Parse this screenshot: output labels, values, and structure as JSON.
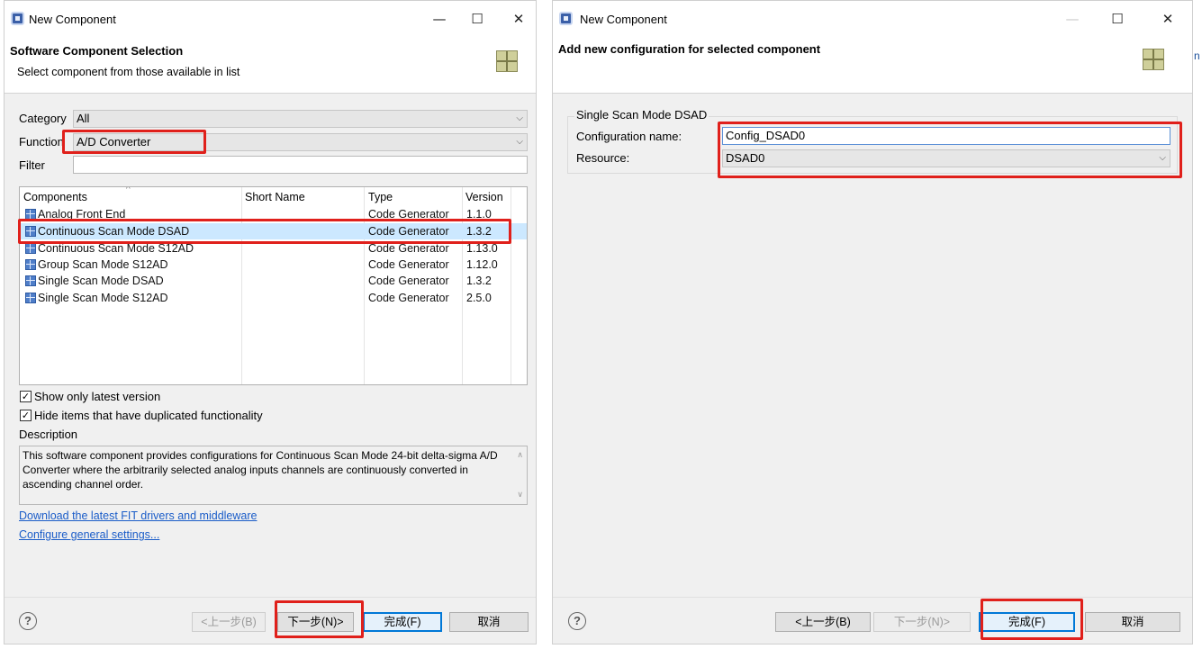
{
  "left_dialog": {
    "title": "New Component",
    "header_title": "Software Component Selection",
    "header_subtitle": "Select component from those available in list",
    "category_label": "Category",
    "category_value": "All",
    "function_label": "Function",
    "function_value": "A/D Converter",
    "filter_label": "Filter",
    "filter_value": "",
    "table": {
      "columns": [
        "Components",
        "Short Name",
        "Type",
        "Version"
      ],
      "rows": [
        {
          "name": "Analog Front End",
          "short": "",
          "type": "Code Generator",
          "version": "1.1.0"
        },
        {
          "name": "Continuous Scan Mode DSAD",
          "short": "",
          "type": "Code Generator",
          "version": "1.3.2"
        },
        {
          "name": "Continuous Scan Mode S12AD",
          "short": "",
          "type": "Code Generator",
          "version": "1.13.0"
        },
        {
          "name": "Group Scan Mode S12AD",
          "short": "",
          "type": "Code Generator",
          "version": "1.12.0"
        },
        {
          "name": "Single Scan Mode DSAD",
          "short": "",
          "type": "Code Generator",
          "version": "1.3.2"
        },
        {
          "name": "Single Scan Mode S12AD",
          "short": "",
          "type": "Code Generator",
          "version": "2.5.0"
        }
      ],
      "selected_row": 1
    },
    "checkbox_latest": "Show only latest version",
    "checkbox_duplicates": "Hide items that have duplicated functionality",
    "description_label": "Description",
    "description_text": "This software component provides configurations for Continuous Scan Mode 24-bit delta-sigma A/D Converter where the arbitrarily selected analog inputs channels are continuously converted in ascending channel order.",
    "link_download": "Download the latest FIT drivers and middleware",
    "link_configure": "Configure general settings...",
    "buttons": {
      "back": "<上一步(B)",
      "next": "下一步(N)>",
      "finish": "完成(F)",
      "cancel": "取消"
    }
  },
  "right_dialog": {
    "title": "New Component",
    "header_title": "Add new configuration for selected component",
    "group_title": "Single Scan Mode DSAD",
    "config_name_label": "Configuration name:",
    "config_name_value": "Config_DSAD0",
    "resource_label": "Resource:",
    "resource_value": "DSAD0",
    "buttons": {
      "back": "<上一步(B)",
      "next": "下一步(N)>",
      "finish": "完成(F)",
      "cancel": "取消"
    }
  },
  "common": {
    "help_glyph": "?",
    "minimize_glyph": "—",
    "maximize_glyph": "☐",
    "close_glyph": "✕",
    "checkmark": "✓",
    "dropdown_arrow": "⌵",
    "sort_arrow": "^",
    "scroll_up": "∧",
    "scroll_down": "∨",
    "edge_glyph": "n",
    "highlight_color": "#e0201b",
    "selection_color": "#cce8ff"
  }
}
